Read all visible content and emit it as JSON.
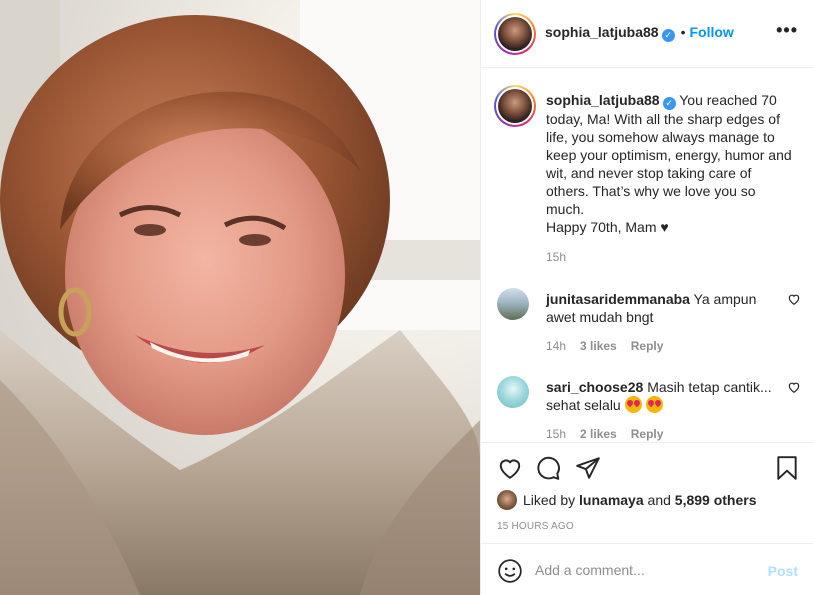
{
  "post": {
    "username": "sophia_latjuba88",
    "verified_badge": "✓",
    "follow_label": "Follow",
    "separator": "•",
    "more_label": "•••"
  },
  "caption": {
    "username": "sophia_latjuba88",
    "text": "You reached 70 today, Ma! With all the sharp edges of life, you somehow always manage to keep your optimism, energy, humor and wit, and never stop taking care of others. That’s why we love you so much.",
    "line2": "Happy 70th, Mam ♥",
    "time": "15h"
  },
  "comments": [
    {
      "username": "junitasaridemmanaba",
      "text": "Ya ampun awet mudah bngt",
      "time": "14h",
      "likes": "3 likes",
      "reply": "Reply"
    },
    {
      "username": "sari_choose28",
      "text": "Masih tetap cantik... sehat selalu",
      "time": "15h",
      "likes": "2 likes",
      "reply": "Reply"
    }
  ],
  "actions": {
    "liked_by_prefix": "Liked by",
    "liked_by_user": "lunamaya",
    "and": "and",
    "others": "5,899 others",
    "post_age": "15 HOURS AGO"
  },
  "add_comment": {
    "placeholder": "Add a comment...",
    "post_label": "Post"
  },
  "icons": {
    "like": "heart-icon",
    "comment": "comment-icon",
    "share": "paper-plane-icon",
    "save": "bookmark-icon",
    "emoji": "smiley-icon",
    "more": "ellipsis-icon"
  },
  "colors": {
    "link_blue": "#0095f6",
    "verified_blue": "#3897f0",
    "muted": "#8e8e8e",
    "disabled_post": "#b2dffc"
  }
}
